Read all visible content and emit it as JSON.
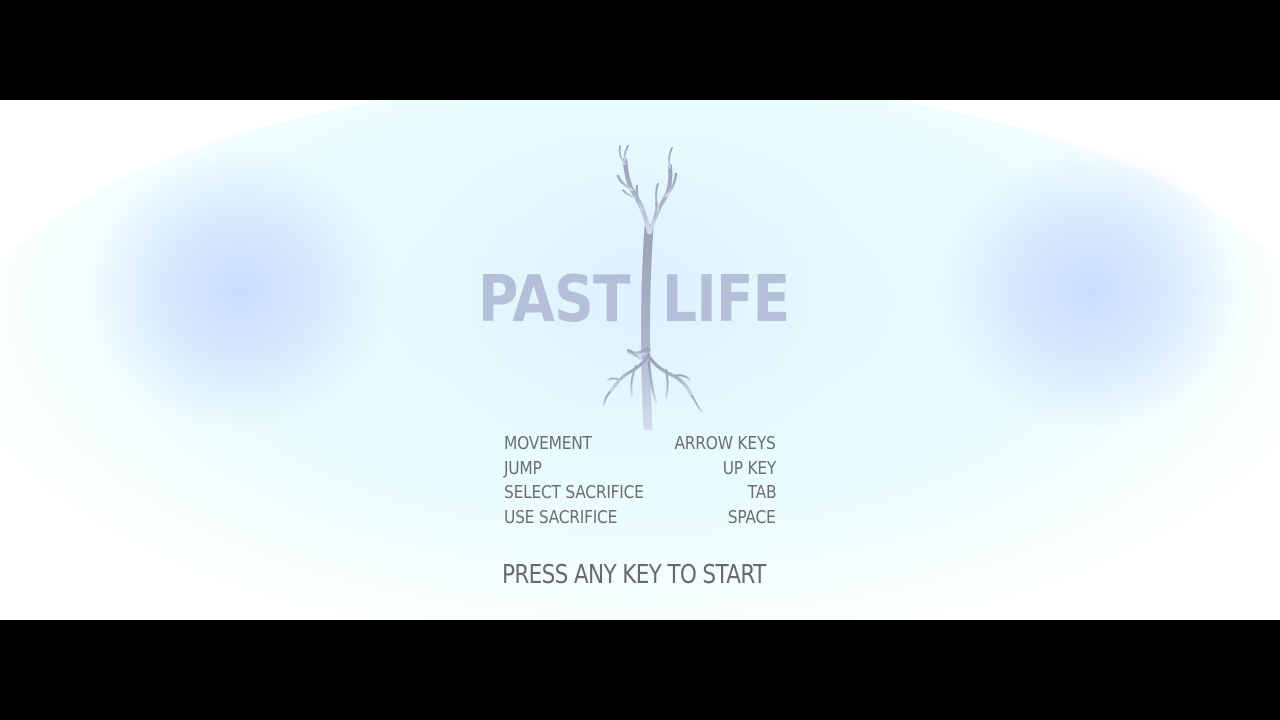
{
  "title": {
    "word_left": "PAST",
    "word_right": "LIFE"
  },
  "controls": [
    {
      "action": "MOVEMENT",
      "key": "ARROW KEYS"
    },
    {
      "action": "JUMP",
      "key": "UP KEY"
    },
    {
      "action": "SELECT SACRIFICE",
      "key": "TAB"
    },
    {
      "action": "USE SACRIFICE",
      "key": "SPACE"
    }
  ],
  "prompt": "PRESS ANY KEY TO START",
  "colors": {
    "letterbox": "#000000",
    "background": "#ffffff",
    "glow_blue": "#c8daff",
    "glow_cyan": "#e1fafc",
    "logo_text": "#b4c0d8",
    "tree_trunk": "#a4aec2",
    "tree_roots": "#c4d0e6",
    "ui_text": "#6e6e72"
  },
  "icons": {
    "logo_tree": "bare-tree-with-roots-icon"
  }
}
